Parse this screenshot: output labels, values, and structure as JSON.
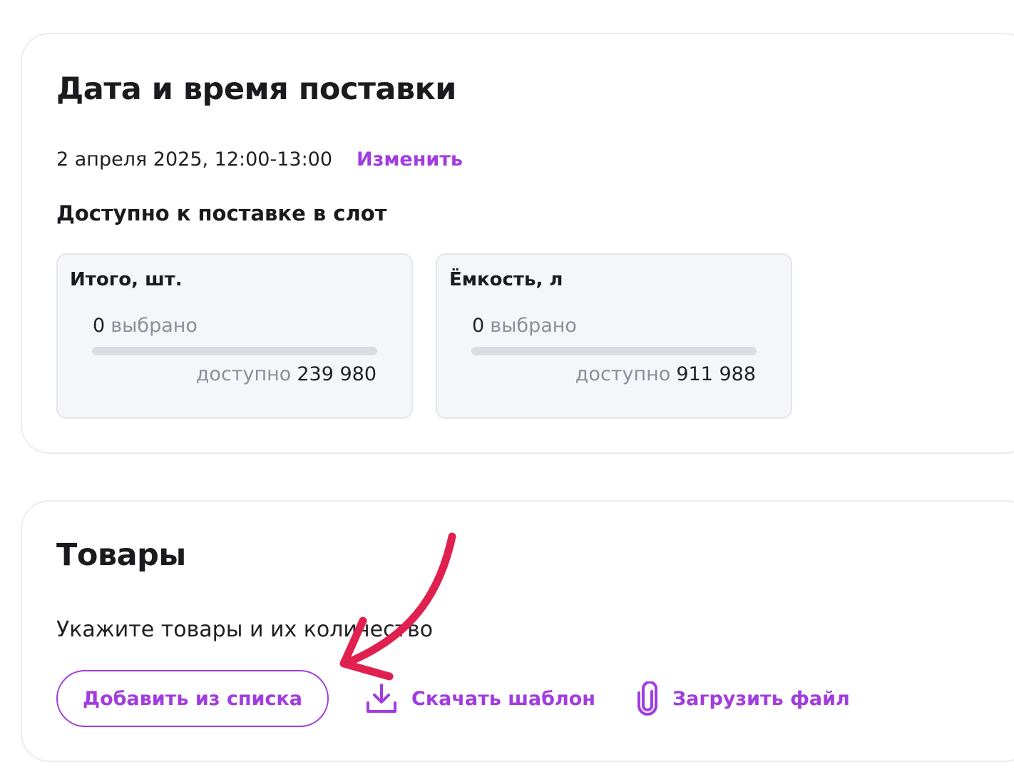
{
  "delivery": {
    "title": "Дата и время поставки",
    "date_text": "2 апреля 2025, 12:00-13:00",
    "change_link": "Изменить",
    "available_heading": "Доступно к поставке в слот",
    "stats": [
      {
        "label": "Итого, шт.",
        "selected_value": "0",
        "selected_text": "выбрано",
        "fill_fraction": 0,
        "available_text": "доступно",
        "available_value": "239 980"
      },
      {
        "label": "Ёмкость, л",
        "selected_value": "0",
        "selected_text": "выбрано",
        "fill_fraction": 0,
        "available_text": "доступно",
        "available_value": "911 988"
      }
    ]
  },
  "goods": {
    "title": "Товары",
    "hint": "Укажите товары и их количество",
    "add_from_list": "Добавить из списка",
    "download_template": "Скачать шаблон",
    "upload_file": "Загрузить файл",
    "icons": {
      "download": "download-icon",
      "upload": "paperclip-icon"
    }
  },
  "annotation": {
    "icon": "curved-arrow-pointer",
    "color": "#e0204e"
  },
  "colors": {
    "accent": "#a13ce0",
    "muted": "#8a8f99",
    "box_bg": "#f5f6f9",
    "bar_track": "#d9dce3"
  }
}
